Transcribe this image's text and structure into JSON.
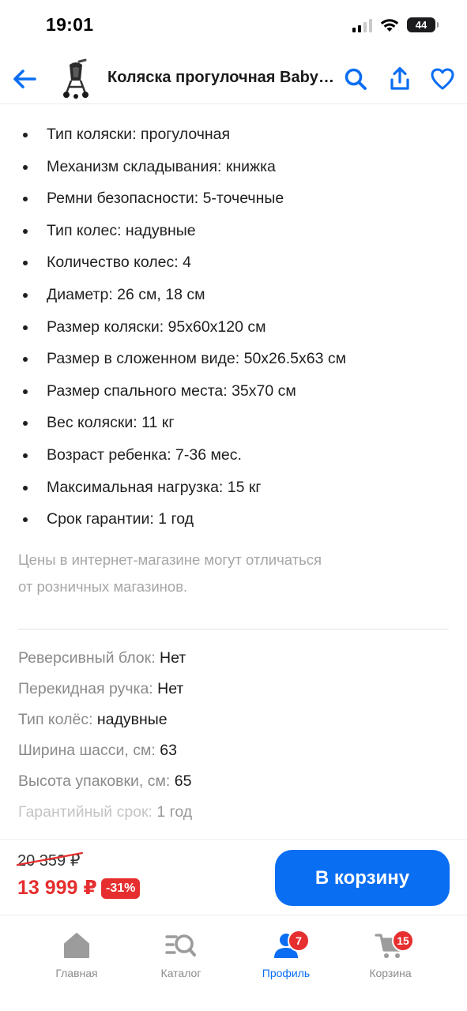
{
  "status_bar": {
    "time": "19:01",
    "battery": "44"
  },
  "header": {
    "title": "Коляска прогулочная Babyt…"
  },
  "specs": [
    "Тип коляски: прогулочная",
    "Механизм складывания: книжка",
    "Ремни безопасности: 5-точечные",
    "Тип колес: надувные",
    "Количество колес: 4",
    "Диаметр: 26 см, 18 см",
    "Размер коляски: 95х60х120 см",
    "Размер в сложенном виде: 50х26.5х63 см",
    "Размер спального места: 35х70 см",
    "Вес коляски: 11 кг",
    "Возраст ребенка: 7-36 мес.",
    "Максимальная нагрузка: 15 кг",
    "Срок гарантии: 1 год"
  ],
  "disclaimer": {
    "line1": "Цены в интернет-магазине могут отличаться",
    "line2": "от розничных магазинов."
  },
  "characteristics": [
    {
      "label": "Реверсивный блок:",
      "value": "Нет"
    },
    {
      "label": "Перекидная ручка:",
      "value": "Нет"
    },
    {
      "label": "Тип колёс:",
      "value": "надувные"
    },
    {
      "label": "Ширина шасси, см:",
      "value": "63"
    },
    {
      "label": "Высота упаковки, см:",
      "value": "65"
    },
    {
      "label": "Гарантийный срок:",
      "value": "1 год"
    }
  ],
  "price": {
    "old": "20 359 ₽",
    "current": "13 999 ₽",
    "discount": "-31%",
    "cart_button": "В корзину"
  },
  "tabs": [
    {
      "label": "Главная",
      "icon": "home-icon"
    },
    {
      "label": "Каталог",
      "icon": "catalog-search-icon"
    },
    {
      "label": "Профиль",
      "icon": "profile-icon",
      "badge": "7",
      "active": true
    },
    {
      "label": "Корзина",
      "icon": "cart-icon",
      "badge": "15"
    }
  ],
  "colors": {
    "accent": "#0a6ef3",
    "sale": "#e62e2e",
    "muted_text": "#8a8a8a"
  }
}
